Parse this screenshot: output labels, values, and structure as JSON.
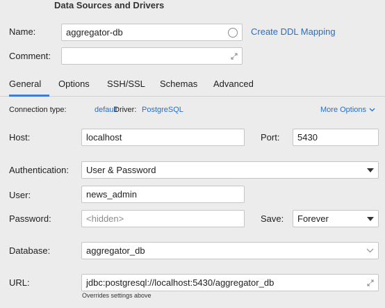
{
  "header": {
    "title": "Data Sources and Drivers"
  },
  "name": {
    "label": "Name:",
    "value": "aggregator-db",
    "ddl_link": "Create DDL Mapping"
  },
  "comment": {
    "label": "Comment:",
    "value": ""
  },
  "tabs": [
    {
      "label": "General",
      "active": true
    },
    {
      "label": "Options"
    },
    {
      "label": "SSH/SSL"
    },
    {
      "label": "Schemas"
    },
    {
      "label": "Advanced"
    }
  ],
  "connection": {
    "type_label": "Connection type:",
    "type_value": "default",
    "driver_label": "Driver:",
    "driver_value": "PostgreSQL",
    "more_options": "More Options"
  },
  "host": {
    "label": "Host:",
    "value": "localhost"
  },
  "port": {
    "label": "Port:",
    "value": "5430"
  },
  "auth": {
    "label": "Authentication:",
    "value": "User & Password"
  },
  "user": {
    "label": "User:",
    "value": "news_admin"
  },
  "password": {
    "label": "Password:",
    "placeholder": "<hidden>"
  },
  "save": {
    "label": "Save:",
    "value": "Forever"
  },
  "database": {
    "label": "Database:",
    "value": "aggregator_db"
  },
  "url": {
    "label": "URL:",
    "value": "jdbc:postgresql://localhost:5430/aggregator_db",
    "hint": "Overrides settings above"
  },
  "colors": {
    "accent": "#3d7ad9",
    "link": "#2a6dbf",
    "background": "#ececec"
  }
}
